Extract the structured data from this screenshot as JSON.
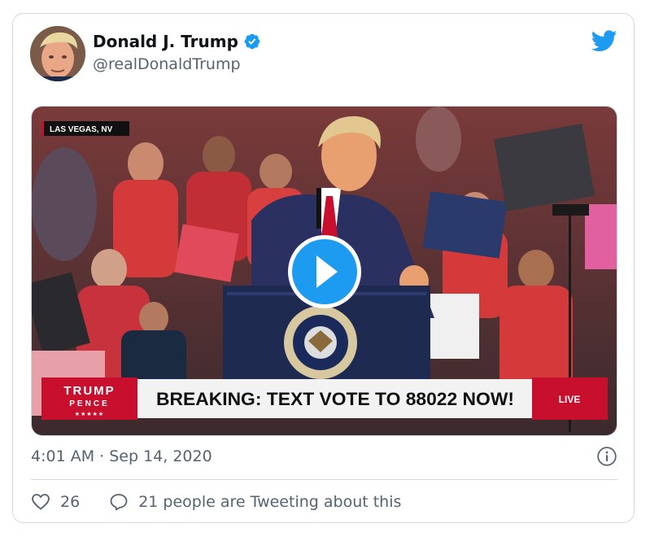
{
  "author": {
    "display_name": "Donald J. Trump",
    "handle": "@realDonaldTrump",
    "verified": true
  },
  "media": {
    "location_tag": "LAS VEGAS, NV",
    "brand_line1": "TRUMP",
    "brand_line2": "PENCE",
    "brand_stars": "★★★★★",
    "ticker": "BREAKING: TEXT VOTE TO 88022 NOW!",
    "live_label": "LIVE",
    "play_icon": "play-icon"
  },
  "meta": {
    "timestamp": "4:01 AM · Sep 14, 2020"
  },
  "actions": {
    "like_count": "26",
    "conversation_text": "21 people are Tweeting about this"
  },
  "colors": {
    "twitter_blue": "#1d9bf0",
    "ticker_red": "#c8102e",
    "text_gray": "#536471"
  }
}
